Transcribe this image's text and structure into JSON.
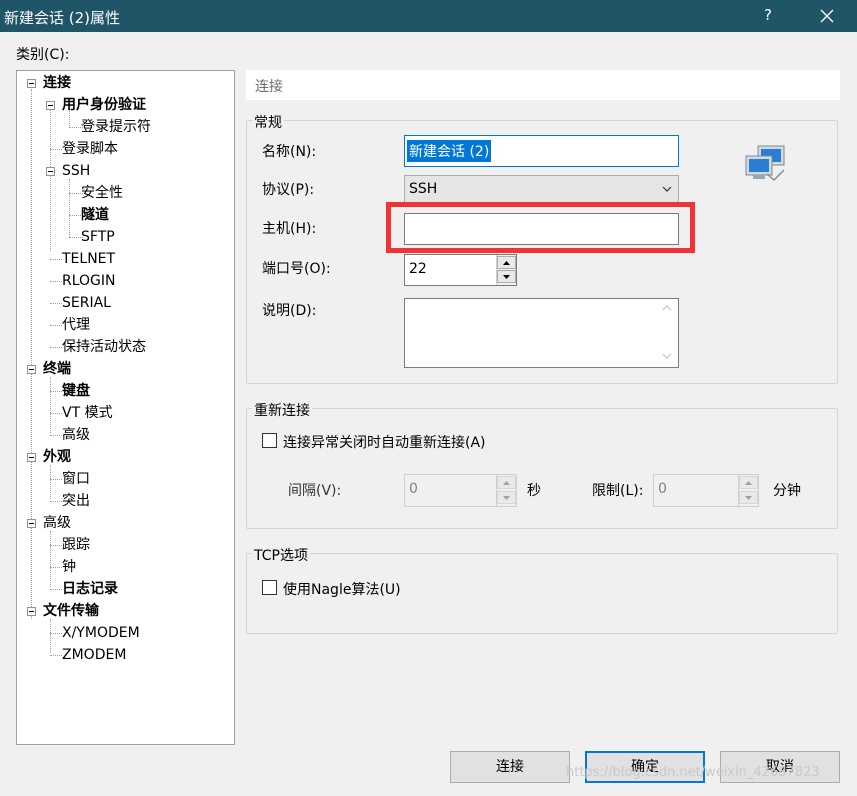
{
  "window": {
    "title": "新建会话 (2)属性",
    "help_label": "?"
  },
  "category_label": "类别(C):",
  "tree": [
    {
      "label": "连接",
      "bold": true
    },
    {
      "label": "用户身份验证",
      "bold": true
    },
    {
      "label": "登录提示符",
      "bold": false
    },
    {
      "label": "登录脚本",
      "bold": false
    },
    {
      "label": "SSH",
      "bold": false
    },
    {
      "label": "安全性",
      "bold": false
    },
    {
      "label": "隧道",
      "bold": true
    },
    {
      "label": "SFTP",
      "bold": false
    },
    {
      "label": "TELNET",
      "bold": false
    },
    {
      "label": "RLOGIN",
      "bold": false
    },
    {
      "label": "SERIAL",
      "bold": false
    },
    {
      "label": "代理",
      "bold": false
    },
    {
      "label": "保持活动状态",
      "bold": false
    },
    {
      "label": "终端",
      "bold": true
    },
    {
      "label": "键盘",
      "bold": true
    },
    {
      "label": "VT 模式",
      "bold": false
    },
    {
      "label": "高级",
      "bold": false
    },
    {
      "label": "外观",
      "bold": true
    },
    {
      "label": "窗口",
      "bold": false
    },
    {
      "label": "突出",
      "bold": false
    },
    {
      "label": "高级",
      "bold": false
    },
    {
      "label": "跟踪",
      "bold": false
    },
    {
      "label": "钟",
      "bold": false
    },
    {
      "label": "日志记录",
      "bold": true
    },
    {
      "label": "文件传输",
      "bold": true
    },
    {
      "label": "X/YMODEM",
      "bold": false
    },
    {
      "label": "ZMODEM",
      "bold": false
    }
  ],
  "panel_header": "连接",
  "general": {
    "title": "常规",
    "name_label": "名称(N):",
    "name_value": "新建会话 (2)",
    "protocol_label": "协议(P):",
    "protocol_value": "SSH",
    "host_label": "主机(H):",
    "host_value": "",
    "port_label": "端口号(O):",
    "port_value": "22",
    "description_label": "说明(D):",
    "description_value": ""
  },
  "reconnect": {
    "title": "重新连接",
    "checkbox_label": "连接异常关闭时自动重新连接(A)",
    "interval_label": "间隔(V):",
    "interval_value": "0",
    "interval_unit": "秒",
    "limit_label": "限制(L):",
    "limit_value": "0",
    "limit_unit": "分钟"
  },
  "tcp": {
    "title": "TCP选项",
    "nagle_label": "使用Nagle算法(U)"
  },
  "buttons": {
    "connect": "连接",
    "ok": "确定",
    "cancel": "取消"
  },
  "watermark": "https://blog.csdn.net/weixin_42687823",
  "colors": {
    "titlebar": "#1f5566",
    "accent": "#0078d7",
    "highlight": "#ee3435"
  }
}
